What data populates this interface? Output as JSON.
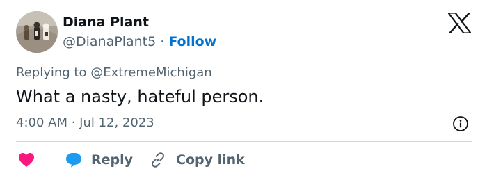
{
  "author": {
    "name": "Diana Plant",
    "handle": "@DianaPlant5",
    "separator": "·",
    "follow_label": "Follow"
  },
  "reply_context": {
    "prefix": "Replying to",
    "target": "@ExtremeMichigan"
  },
  "tweet": {
    "text": "What a nasty, hateful person.",
    "timestamp": "4:00 AM · Jul 12, 2023"
  },
  "actions": {
    "reply_label": "Reply",
    "copy_link_label": "Copy link"
  },
  "icons": {
    "logo": "x-logo-icon",
    "info": "info-icon",
    "like": "heart-icon",
    "reply": "speech-bubble-icon",
    "copy_link": "link-icon"
  },
  "colors": {
    "heart": "#f91880",
    "reply_bubble": "#1d9bf0",
    "follow": "#0073d2",
    "secondary_text": "#536471",
    "primary_text": "#0f1419"
  }
}
